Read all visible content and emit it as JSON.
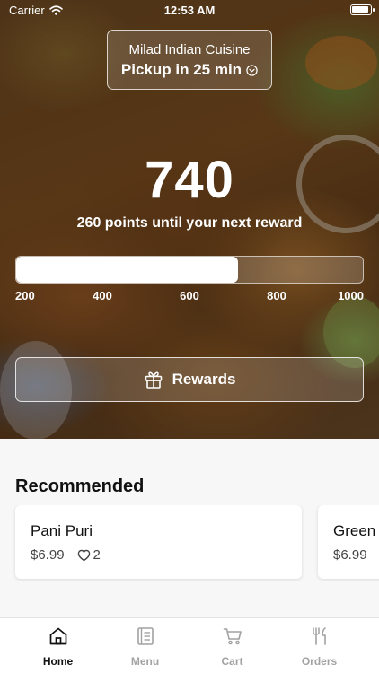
{
  "status_bar": {
    "carrier": "Carrier",
    "time": "12:53 AM"
  },
  "location": {
    "name": "Milad Indian Cuisine",
    "pickup": "Pickup in 25 min"
  },
  "loyalty": {
    "points": "740",
    "caption": "260 points until your next reward",
    "progress_fraction": 0.64,
    "ticks": [
      "200",
      "400",
      "600",
      "800",
      "1000"
    ],
    "rewards_label": "Rewards"
  },
  "recommended": {
    "title": "Recommended",
    "items": [
      {
        "name": "Pani Puri",
        "price": "$6.99",
        "likes": "2"
      },
      {
        "name": "Green",
        "price": "$6.99"
      }
    ]
  },
  "tabs": [
    {
      "label": "Home",
      "icon": "home-icon",
      "active": true
    },
    {
      "label": "Menu",
      "icon": "menu-icon",
      "active": false
    },
    {
      "label": "Cart",
      "icon": "cart-icon",
      "active": false
    },
    {
      "label": "Orders",
      "icon": "orders-icon",
      "active": false
    }
  ],
  "colors": {
    "accent": "#111111",
    "inactive_tab": "#a2a2a2",
    "background": "#f7f7f7"
  }
}
